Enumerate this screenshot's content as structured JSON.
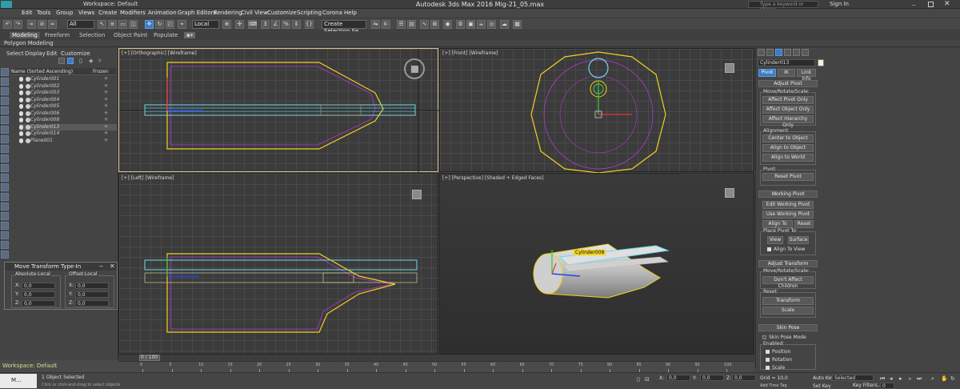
{
  "window": {
    "title": "Autodesk 3ds Max 2016      Mig-21_05.max",
    "workspace": "Workspace: Default",
    "search_placeholder": "Type a keyword or phrase",
    "sign_in": "Sign In"
  },
  "menu": [
    "Edit",
    "Tools",
    "Group",
    "Views",
    "Create",
    "Modifiers",
    "Animation",
    "Graph Editors",
    "Rendering",
    "Civil View",
    "Customize",
    "Scripting",
    "Corona",
    "Help"
  ],
  "toolbar": {
    "filter_value": "All",
    "ref_coord": "Local",
    "selection_set": "Create Selection Se"
  },
  "ribbon": {
    "tabs": [
      "Modeling",
      "Freeform",
      "Selection",
      "Object Paint",
      "Populate"
    ],
    "sub": "Polygon Modeling"
  },
  "explorer": {
    "menu": [
      "Select",
      "Display",
      "Edit",
      "Customize"
    ],
    "col_name": "Name (Sorted Ascending)",
    "col_frozen": "Frozen",
    "rows": [
      {
        "name": "Cylinder001",
        "sel": false
      },
      {
        "name": "Cylinder002",
        "sel": false
      },
      {
        "name": "Cylinder003",
        "sel": false
      },
      {
        "name": "Cylinder004",
        "sel": false
      },
      {
        "name": "Cylinder005",
        "sel": false
      },
      {
        "name": "Cylinder006",
        "sel": false
      },
      {
        "name": "Cylinder008",
        "sel": false
      },
      {
        "name": "Cylinder013",
        "sel": true
      },
      {
        "name": "Cylinder014",
        "sel": false
      },
      {
        "name": "Plane001",
        "sel": false
      }
    ]
  },
  "viewports": {
    "top_left": "[+] [Orthographic] [Wireframe]",
    "top_right": "[+] [Front] [Wireframe]",
    "bottom_left": "[+] [Left] [Wireframe]",
    "bottom_right": "[+] [Perspective] [Shaded + Edged Faces]",
    "persp_tag": "Cylinder008"
  },
  "typein": {
    "title": "Move Transform Type-In",
    "abs_label": "Absolute:Local",
    "off_label": "Offset:Local",
    "axes": [
      "X:",
      "Y:",
      "Z:"
    ],
    "abs_values": [
      "0,0",
      "0,0",
      "0,0"
    ],
    "off_values": [
      "0,0",
      "0,0",
      "0,0"
    ]
  },
  "cmd": {
    "object_name": "Cylinder013",
    "tabs": [
      "Pivot",
      "IK",
      "Link Info"
    ],
    "adjust_pivot": "Adjust Pivot",
    "move_rotate_scale": "Move/Rotate/Scale:",
    "affect_pivot": "Affect Pivot Only",
    "affect_object": "Affect Object Only",
    "affect_hierarchy": "Affect Hierarchy Only",
    "alignment": "Alignment:",
    "center_to_object": "Center to Object",
    "align_to_object": "Align to Object",
    "align_to_world": "Align to World",
    "pivot": "Pivot:",
    "reset_pivot": "Reset Pivot",
    "working_pivot": "Working Pivot",
    "edit_working_pivot": "Edit Working Pivot",
    "use_working_pivot": "Use Working Pivot",
    "align_to_view": "Align To View",
    "reset": "Reset",
    "place_pivot_to": "Place Pivot To:",
    "view": "View",
    "surface": "Surface",
    "align_to_view_chk": "Align To View",
    "adjust_transform": "Adjust Transform",
    "dont_affect_children": "Don't Affect Children",
    "reset_label": "Reset:",
    "transform": "Transform",
    "scale": "Scale",
    "skin_pose": "Skin Pose",
    "skin_pose_mode": "Skin Pose Mode",
    "enabled": "Enabled:",
    "position": "Position",
    "rotation": "Rotation",
    "scale_chk": "Scale"
  },
  "timeline": {
    "frame": "0 / 100",
    "ticks": [
      "0",
      "5",
      "10",
      "15",
      "20",
      "25",
      "30",
      "35",
      "40",
      "45",
      "50",
      "55",
      "60",
      "65",
      "70",
      "75",
      "80",
      "85",
      "90",
      "95",
      "100"
    ]
  },
  "status": {
    "workspace": "Workspace: Default",
    "selected": "1 Object Selected",
    "prompt": "Click or click-and-drag to select objects",
    "x_label": "X:",
    "x_val": "0,0",
    "y_label": "Y:",
    "y_val": "0,0",
    "z_label": "Z:",
    "z_val": "0,0",
    "grid": "Grid = 10,0",
    "add_time_tag": "Add Time Tag",
    "auto_key": "Auto Key",
    "set_key": "Set Key",
    "selected_dropdown": "Selected",
    "key_filters": "Key Filters...",
    "frame_field": "0",
    "maxscript": "M..."
  },
  "colors": {
    "accent": "#3d7bc3",
    "selection_yellow": "#f2d21c",
    "wire_magenta": "#b03ad0",
    "wire_cyan": "#6fd7ef"
  }
}
